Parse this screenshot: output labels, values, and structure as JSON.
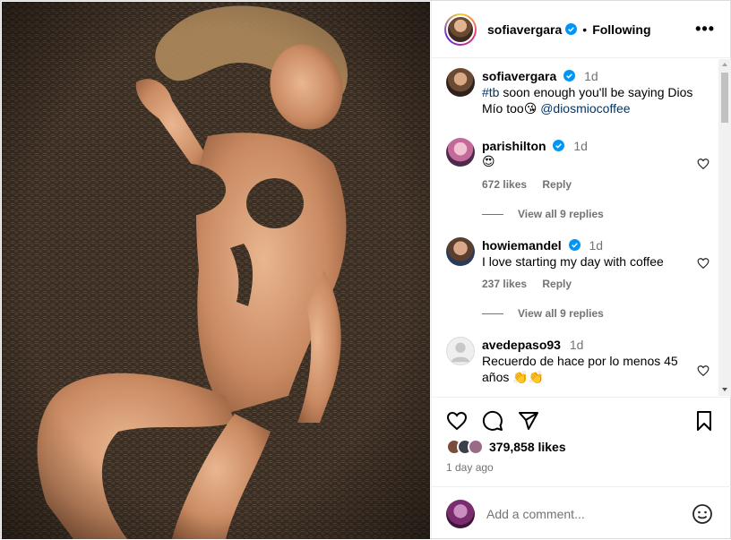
{
  "post": {
    "author": "sofiavergara",
    "follow_state": "Following",
    "more_label": "•••",
    "caption": {
      "time": "1d",
      "hashtag": "#tb",
      "text": " soon enough you'll be saying Dios Mío too",
      "emoji": "😘",
      "mention": "@diosmiocoffee"
    }
  },
  "comments": [
    {
      "user": "parishilton",
      "verified": true,
      "time": "1d",
      "text": "😍",
      "likes": "672 likes",
      "reply": "Reply",
      "view_replies": "View all 9 replies"
    },
    {
      "user": "howiemandel",
      "verified": true,
      "time": "1d",
      "text": "I love starting my day with coffee",
      "likes": "237 likes",
      "reply": "Reply",
      "view_replies": "View all 9 replies"
    },
    {
      "user": "avedepaso93",
      "verified": false,
      "time": "1d",
      "text": "Recuerdo de hace por lo menos 45 años 👏👏"
    }
  ],
  "actions": {
    "likes": "379,858 likes",
    "time_ago": "1 day ago",
    "icons": [
      "heart-icon",
      "comment-icon",
      "share-icon",
      "bookmark-icon"
    ]
  },
  "add_comment": {
    "placeholder": "Add a comment...",
    "emoji_icon": "smiley-icon"
  },
  "colors": {
    "link": "#00376b",
    "secondary": "#737373",
    "verified": "#0095f6"
  }
}
